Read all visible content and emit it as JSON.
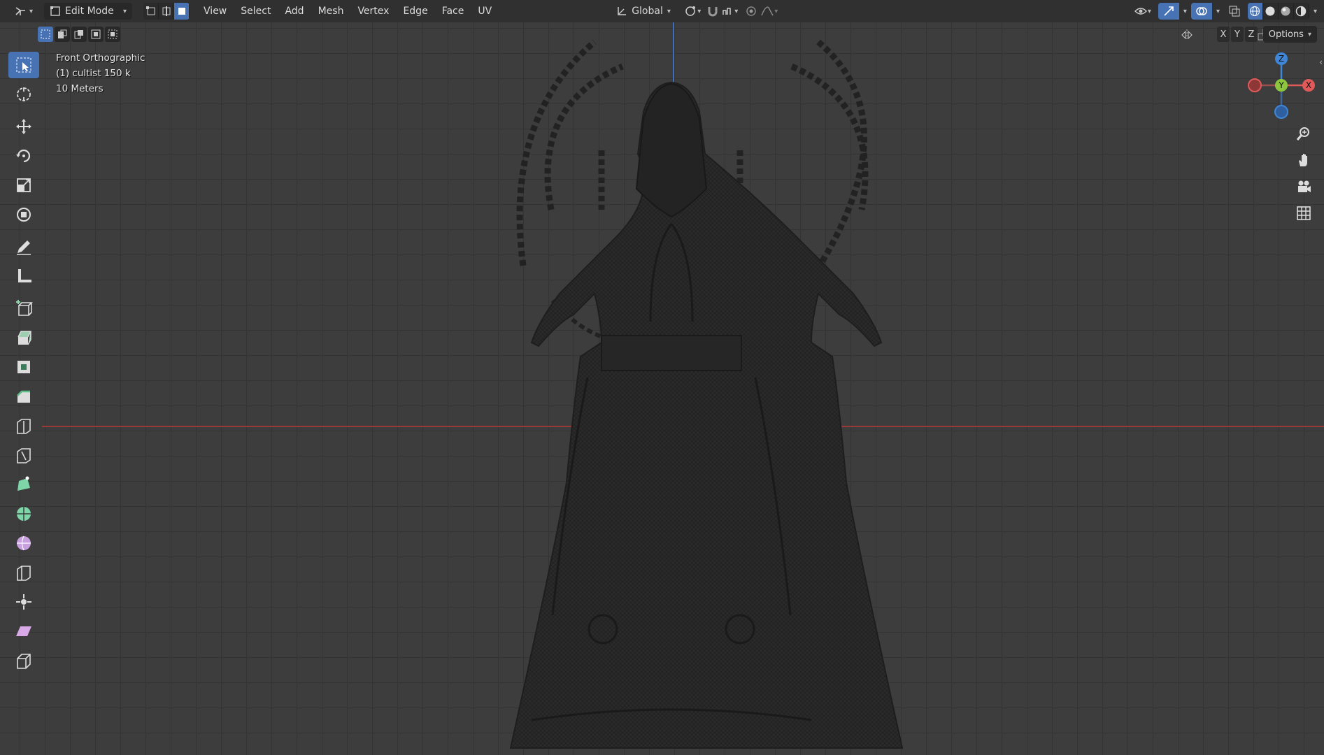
{
  "header": {
    "mode_label": "Edit Mode",
    "menus": [
      "View",
      "Select",
      "Add",
      "Mesh",
      "Vertex",
      "Edge",
      "Face",
      "UV"
    ],
    "transform_orientation": "Global",
    "options_label": "Options",
    "axis_toggles": [
      "X",
      "Y",
      "Z"
    ]
  },
  "viewport": {
    "view_name": "Front Orthographic",
    "object_label": "(1) cultist 150 k",
    "scale_label": "10 Meters"
  },
  "gizmo": {
    "z": "Z",
    "y": "Y",
    "x": "X"
  },
  "colors": {
    "accent": "#4772b3",
    "x_axis": "#9b3838",
    "z_axis": "#3e6fbe",
    "gizmo_x": "#e05a5a",
    "gizmo_y": "#8cc63f",
    "gizmo_z": "#3f86d6"
  },
  "toolbar": [
    "select-box",
    "cursor",
    "move",
    "rotate",
    "scale",
    "transform",
    "annotate",
    "measure",
    "add-cube",
    "extrude",
    "inset",
    "bevel",
    "loop-cut",
    "knife",
    "poly-build",
    "spin",
    "smooth",
    "edge-slide",
    "shrink-fatten",
    "shear",
    "rip-region"
  ]
}
